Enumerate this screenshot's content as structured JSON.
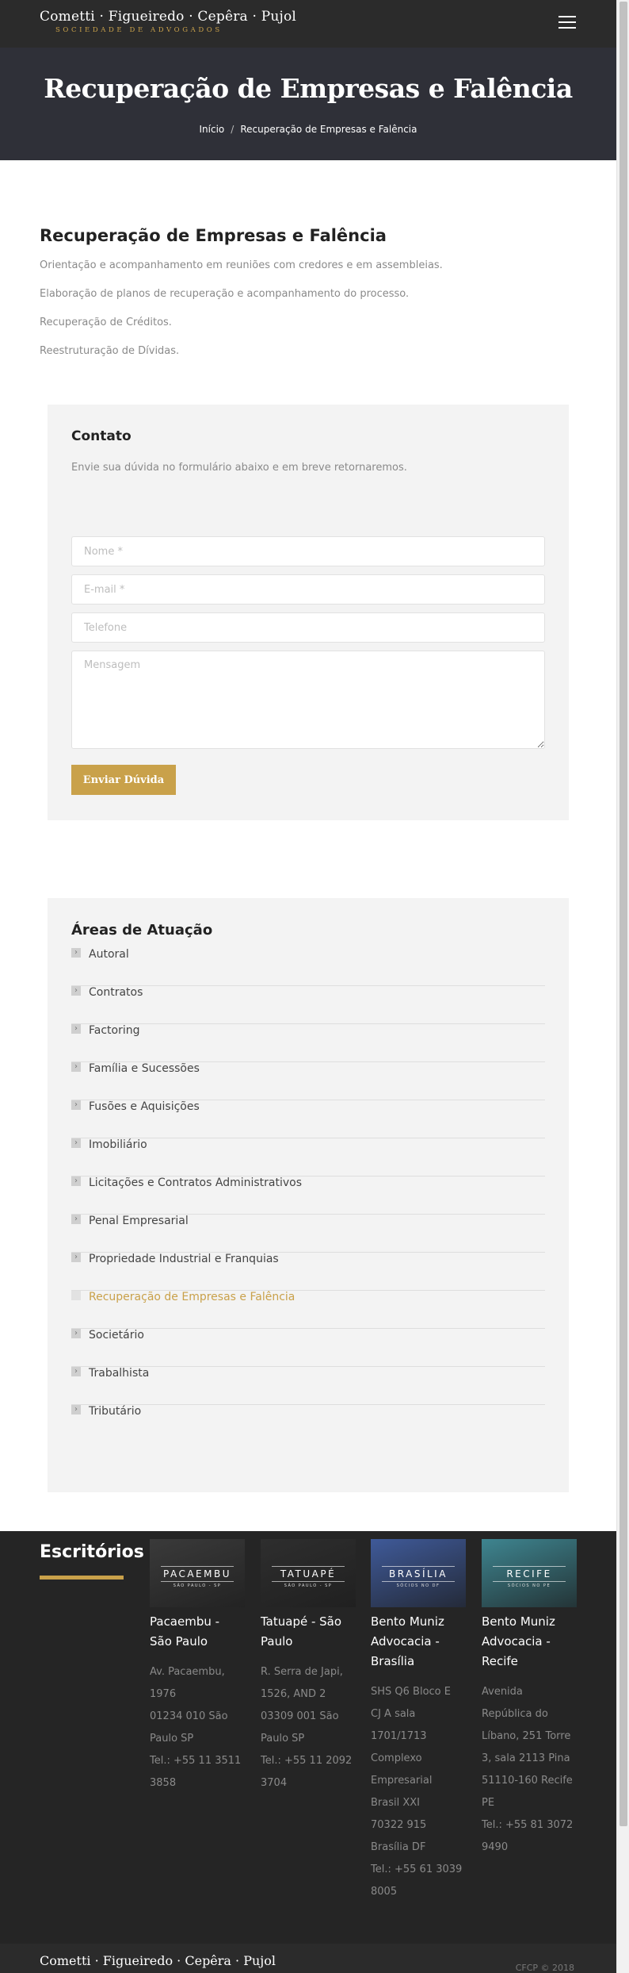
{
  "header": {
    "logo_main": "Cometti · Figueiredo · Cepêra · Pujol",
    "logo_sub": "SOCIEDADE DE ADVOGADOS",
    "menu_icon": "hamburger-menu-icon"
  },
  "hero": {
    "title": "Recuperação de Empresas e Falência",
    "breadcrumb_home": "Início",
    "breadcrumb_sep": "/",
    "breadcrumb_current": "Recuperação de Empresas e Falência"
  },
  "main": {
    "heading": "Recuperação de Empresas e Falência",
    "items": [
      "Orientação e acompanhamento em reuniões com credores e em assembleias.",
      "Elaboração de planos de recuperação e acompanhamento do processo.",
      "Recuperação de Créditos.",
      "Reestruturação de Dívidas."
    ]
  },
  "contact": {
    "title": "Contato",
    "intro": "Envie sua dúvida no formulário abaixo e em breve retornaremos.",
    "name_placeholder": "Nome *",
    "email_placeholder": "E-mail *",
    "phone_placeholder": "Telefone",
    "message_placeholder": "Mensagem",
    "submit_label": "Enviar Dúvida"
  },
  "areas": {
    "title": "Áreas de Atuação",
    "items": [
      "Autoral",
      "Contratos",
      "Factoring",
      "Família e Sucessões",
      "Fusões e Aquisições",
      "Imobiliário",
      "Licitações e Contratos Administrativos",
      "Penal Empresarial",
      "Propriedade Industrial e Franquias",
      "Recuperação de Empresas e Falência",
      "Societário",
      "Trabalhista",
      "Tributário"
    ],
    "active_index": 9
  },
  "footer": {
    "title": "Escritórios",
    "offices": [
      {
        "image_label": "PACAEMBU",
        "image_sub": "SÃO PAULO - SP",
        "name": "Pacaembu - São Paulo",
        "address_lines": [
          "Av. Pacaembu,",
          "1976",
          "01234 010 São",
          "Paulo SP",
          "Tel.: +55 11 3511",
          "3858"
        ],
        "color": "#3a3a3a"
      },
      {
        "image_label": "TATUAPÉ",
        "image_sub": "SÃO PAULO - SP",
        "name": "Tatuapé - São Paulo",
        "address_lines": [
          "R. Serra de Japi,",
          "1526, AND 2",
          "03309 001 São",
          "Paulo SP",
          "Tel.: +55 11 2092",
          "3704"
        ],
        "color": "#2e2e2e"
      },
      {
        "image_label": "BRASÍLIA",
        "image_sub": "SÓCIOS NO DF",
        "name": "Bento Muniz Advocacia - Brasília",
        "address_lines": [
          "SHS Q6 Bloco E",
          "CJ A sala",
          "1701/1713",
          "Complexo",
          "Empresarial",
          "Brasil XXI",
          "70322 915",
          "Brasília DF",
          "Tel.: +55 61 3039",
          "8005"
        ],
        "color": "#3f5a99"
      },
      {
        "image_label": "RECIFE",
        "image_sub": "SÓCIOS NO PE",
        "name": "Bento Muniz Advocacia - Recife",
        "address_lines": [
          "Avenida",
          "República do",
          "Líbano, 251 Torre",
          "3, sala 2113 Pina",
          "51110-160 Recife",
          "PE",
          "Tel.: +55 81 3072",
          "9490"
        ],
        "color": "#3e8590"
      }
    ]
  },
  "bottom": {
    "logo": "Cometti · Figueiredo · Cepêra · Pujol",
    "copyright": "CFCP © 2018"
  },
  "colors": {
    "accent": "#c9a14a",
    "dark": "#252525",
    "hero_bg": "#2f3038",
    "panel_bg": "#f3f3f3"
  }
}
